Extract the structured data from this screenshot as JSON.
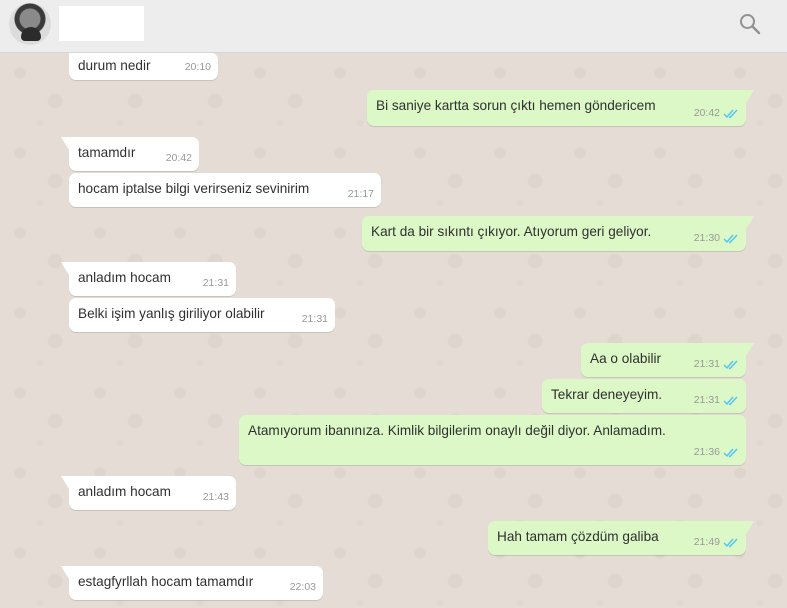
{
  "header": {
    "avatar": "profile-photo",
    "search_icon": "search-icon"
  },
  "colors": {
    "incoming": "#ffffff",
    "outgoing": "#dcf8c6",
    "read_ticks": "#4fc3f7",
    "wallpaper": "#e5ddd5"
  },
  "messages": [
    {
      "dir": "in",
      "text": "durum nedir",
      "time": "20:10"
    },
    {
      "dir": "out",
      "text": "Bi saniye kartta sorun çıktı hemen göndericem",
      "time": "20:42",
      "status": "read"
    },
    {
      "dir": "in",
      "text": "tamamdır",
      "time": "20:42"
    },
    {
      "dir": "in",
      "text": "hocam iptalse bilgi verirseniz sevinirim",
      "time": "21:17"
    },
    {
      "dir": "out",
      "text": "Kart da bir sıkıntı çıkıyor. Atıyorum geri geliyor.",
      "time": "21:30",
      "status": "read"
    },
    {
      "dir": "in",
      "text": "anladım hocam",
      "time": "21:31"
    },
    {
      "dir": "in",
      "text": "Belki işim yanlış giriliyor olabilir",
      "time": "21:31"
    },
    {
      "dir": "out",
      "text": "Aa o olabilir",
      "time": "21:31",
      "status": "read"
    },
    {
      "dir": "out",
      "text": "Tekrar deneyeyim.",
      "time": "21:31",
      "status": "read"
    },
    {
      "dir": "out",
      "text": "Atamıyorum ibanınıza. Kimlik bilgilerim onaylı değil diyor. Anlamadım.",
      "time": "21:36",
      "status": "read"
    },
    {
      "dir": "in",
      "text": "anladım hocam",
      "time": "21:43"
    },
    {
      "dir": "out",
      "text": "Hah tamam çözdüm galiba",
      "time": "21:49",
      "status": "read"
    },
    {
      "dir": "in",
      "text": "estagfyrllah hocam tamamdır",
      "time": "22:03"
    }
  ]
}
